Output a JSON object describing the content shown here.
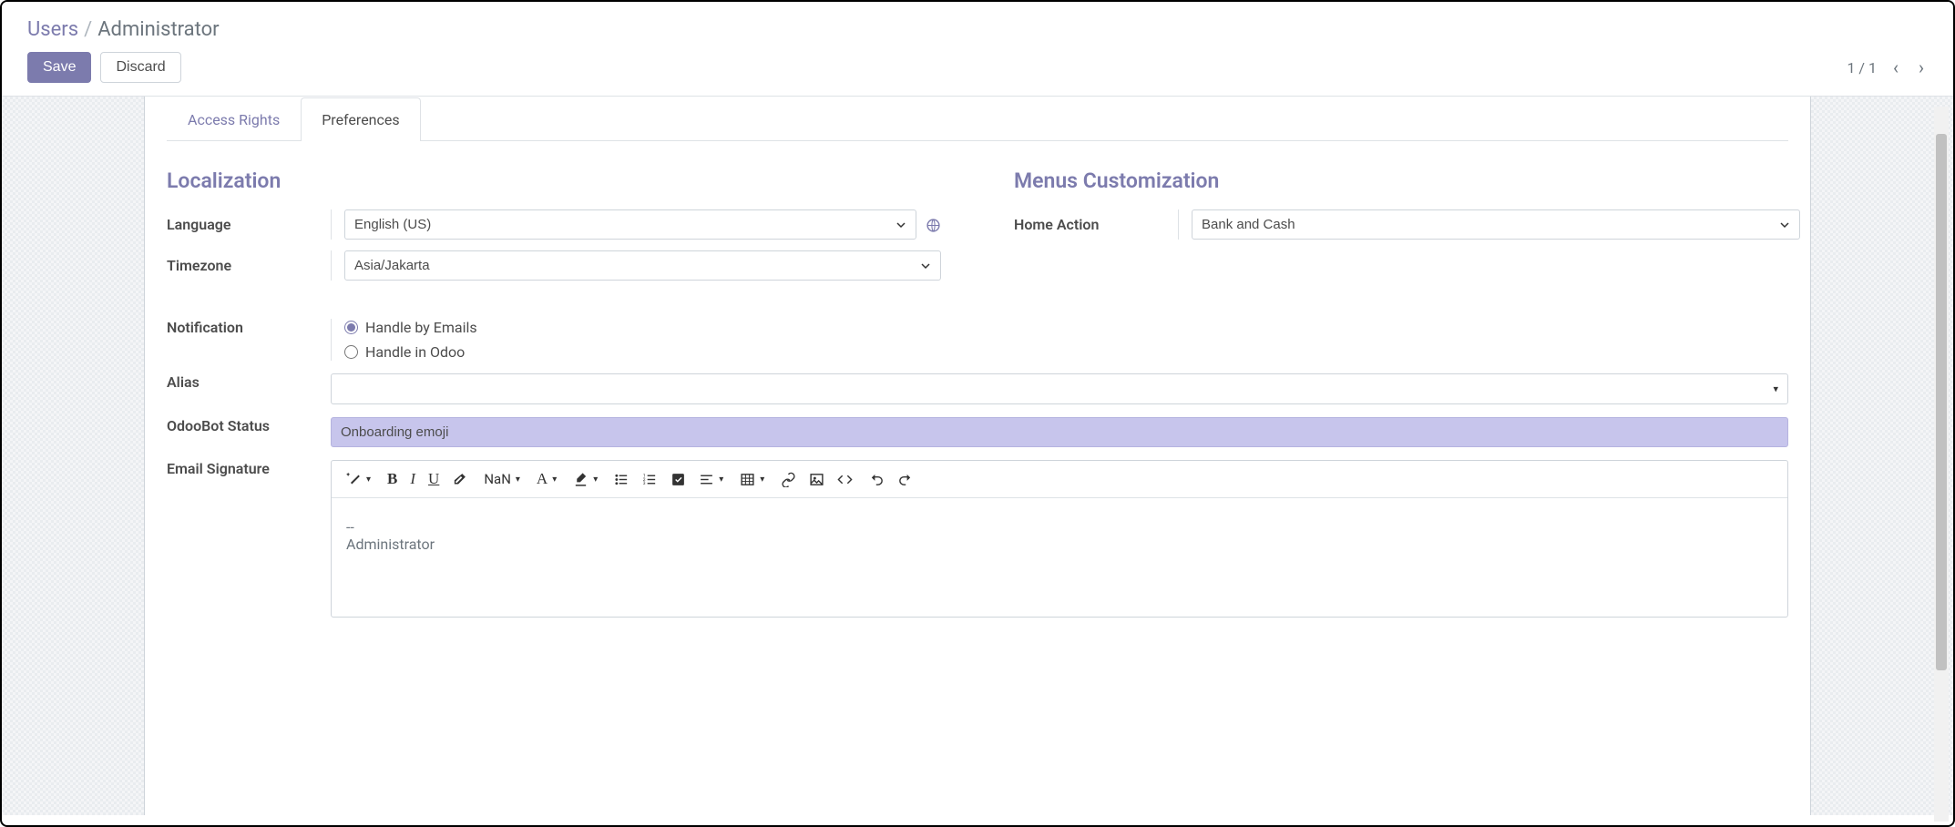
{
  "breadcrumb": {
    "parent": "Users",
    "separator": "/",
    "current": "Administrator"
  },
  "header": {
    "save_label": "Save",
    "discard_label": "Discard",
    "pager": "1 / 1"
  },
  "tabs": {
    "access_rights": "Access Rights",
    "preferences": "Preferences"
  },
  "sections": {
    "localization": {
      "title": "Localization",
      "language_label": "Language",
      "language_value": "English (US)",
      "timezone_label": "Timezone",
      "timezone_value": "Asia/Jakarta"
    },
    "menus": {
      "title": "Menus Customization",
      "home_action_label": "Home Action",
      "home_action_value": "Bank and Cash"
    },
    "notification": {
      "label": "Notification",
      "option_email": "Handle by Emails",
      "option_odoo": "Handle in Odoo"
    },
    "alias": {
      "label": "Alias",
      "value": ""
    },
    "odoobot": {
      "label": "OdooBot Status",
      "value": "Onboarding emoji"
    },
    "signature": {
      "label": "Email Signature",
      "body_line1": "--",
      "body_line2": "Administrator"
    }
  },
  "editor_toolbar": {
    "fontsize": "NaN",
    "fontname": "A"
  }
}
